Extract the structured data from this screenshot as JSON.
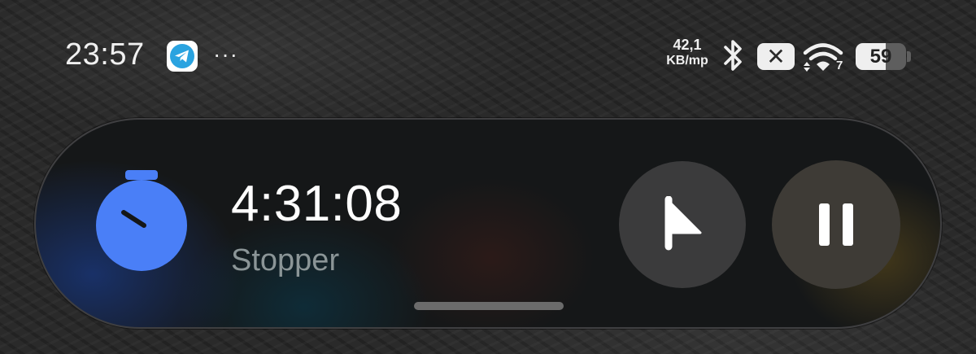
{
  "status_bar": {
    "time": "23:57",
    "notification_icons": [
      "telegram-icon",
      "more-icon"
    ],
    "more_dots": "···",
    "network_speed": {
      "value": "42,1",
      "unit": "KB/mp"
    },
    "bluetooth": "bluetooth-icon",
    "sim_status": "no-sim-icon",
    "sim_glyph": "✕",
    "wifi_badge": "7",
    "battery_percent": "59",
    "battery_level": 0.59
  },
  "live_activity": {
    "icon": "stopwatch-icon",
    "timer": "4:31:08",
    "label": "Stopper",
    "buttons": [
      "lap-flag-button",
      "pause-button"
    ],
    "accent_color": "#4a7ff7"
  }
}
